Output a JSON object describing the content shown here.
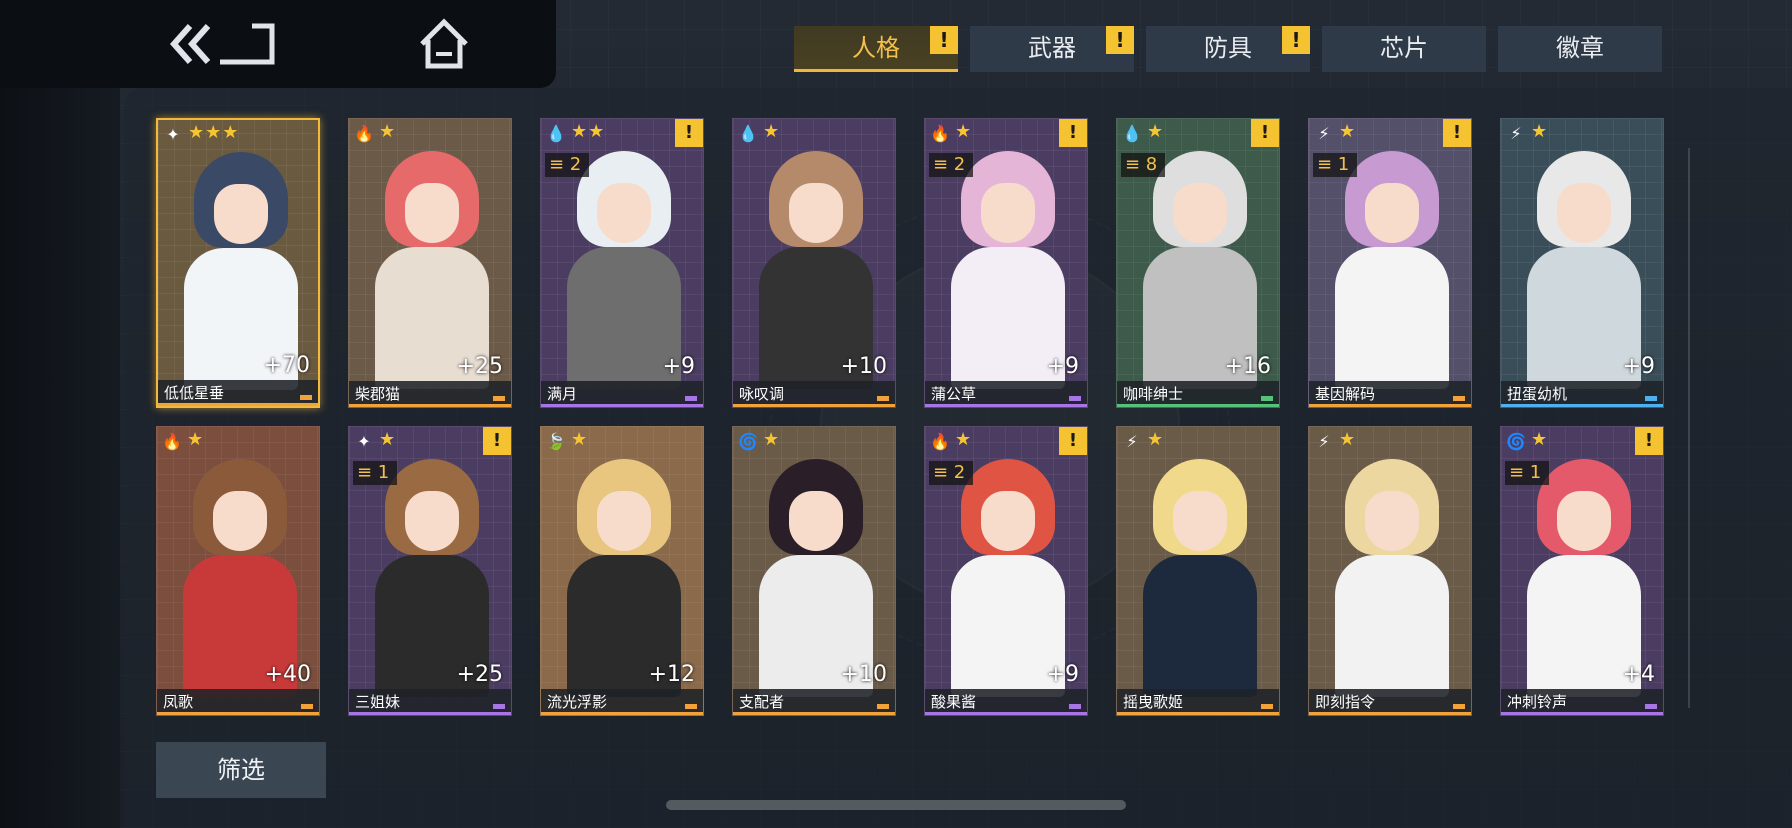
{
  "nav": {
    "back_label": "",
    "home_label": ""
  },
  "tabs": [
    {
      "label": "人格",
      "alert": "!",
      "active": true
    },
    {
      "label": "武器",
      "alert": "!"
    },
    {
      "label": "防具",
      "alert": "!"
    },
    {
      "label": "芯片",
      "alert": ""
    },
    {
      "label": "徽章",
      "alert": ""
    }
  ],
  "cards": [
    {
      "name": "低低星垂",
      "level": "+70",
      "stars": "★★★",
      "element": "✦",
      "elementColor": "#ffffff",
      "alert": "",
      "rank": "",
      "bg": "#6a5a40",
      "hair": "#3a4a66",
      "body": "#f2f5f8",
      "tag": "#f2a23a",
      "selected": true
    },
    {
      "name": "柴郡猫",
      "level": "+25",
      "stars": "★",
      "element": "🔥",
      "elementColor": "#ff5b3a",
      "alert": "",
      "rank": "",
      "bg": "#6c5a48",
      "hair": "#e66a6a",
      "body": "#e7ddd1",
      "tag": "#f2a23a"
    },
    {
      "name": "满月",
      "level": "+9",
      "stars": "★★",
      "element": "💧",
      "elementColor": "#6ec1ff",
      "alert": "!",
      "rank": "≡ 2",
      "bg": "#4b3c62",
      "hair": "#e9eef2",
      "body": "#6e6e6e",
      "tag": "#a874e6"
    },
    {
      "name": "咏叹调",
      "level": "+10",
      "stars": "★",
      "element": "💧",
      "elementColor": "#6ec1ff",
      "alert": "",
      "rank": "",
      "bg": "#4b3c62",
      "hair": "#b48a6a",
      "body": "#333333",
      "tag": "#f2a23a"
    },
    {
      "name": "蒲公草",
      "level": "+9",
      "stars": "★",
      "element": "🔥",
      "elementColor": "#ff5b3a",
      "alert": "!",
      "rank": "≡ 2",
      "bg": "#4b3c62",
      "hair": "#e5b5d8",
      "body": "#f3eef6",
      "tag": "#a874e6"
    },
    {
      "name": "咖啡绅士",
      "level": "+16",
      "stars": "★",
      "element": "💧",
      "elementColor": "#6ec1ff",
      "alert": "!",
      "rank": "≡ 8",
      "bg": "#3d5a4a",
      "hair": "#dedede",
      "body": "#c0c0c0",
      "tag": "#55c27a"
    },
    {
      "name": "基因解码",
      "level": "",
      "stars": "★",
      "element": "⚡",
      "elementColor": "#ffffff",
      "alert": "!",
      "rank": "≡ 1",
      "bg": "#55506a",
      "hair": "#c79ad1",
      "body": "#f4f4f4",
      "tag": "#f2a23a"
    },
    {
      "name": "扭蛋幼机",
      "level": "+9",
      "stars": "★",
      "element": "⚡",
      "elementColor": "#ffffff",
      "alert": "",
      "rank": "",
      "bg": "#3a4e5a",
      "hair": "#e8e8e8",
      "body": "#cfd8dc",
      "tag": "#4fb0ee"
    },
    {
      "name": "凤歌",
      "level": "+40",
      "stars": "★",
      "element": "🔥",
      "elementColor": "#ff5b3a",
      "alert": "",
      "rank": "",
      "bg": "#7b4e3e",
      "hair": "#8a5a3a",
      "body": "#c83a3a",
      "tag": "#f2a23a"
    },
    {
      "name": "三姐妹",
      "level": "+25",
      "stars": "★",
      "element": "✦",
      "elementColor": "#ffffff",
      "alert": "!",
      "rank": "≡ 1",
      "bg": "#4b3c62",
      "hair": "#9a6a42",
      "body": "#2b2b2b",
      "tag": "#a874e6"
    },
    {
      "name": "流光浮影",
      "level": "+12",
      "stars": "★",
      "element": "🍃",
      "elementColor": "#6ed37a",
      "alert": "",
      "rank": "",
      "bg": "#8a6a4a",
      "hair": "#e8c680",
      "body": "#2b2b2b",
      "tag": "#f2a23a"
    },
    {
      "name": "支配者",
      "level": "+10",
      "stars": "★",
      "element": "🌀",
      "elementColor": "#c17bea",
      "alert": "",
      "rank": "",
      "bg": "#6a5a48",
      "hair": "#2a1e28",
      "body": "#ececec",
      "tag": "#f2a23a"
    },
    {
      "name": "酸果酱",
      "level": "+9",
      "stars": "★",
      "element": "🔥",
      "elementColor": "#ff5b3a",
      "alert": "!",
      "rank": "≡ 2",
      "bg": "#4b3c62",
      "hair": "#e05444",
      "body": "#f4f4f4",
      "tag": "#a874e6"
    },
    {
      "name": "摇曳歌姬",
      "level": "",
      "stars": "★",
      "element": "⚡",
      "elementColor": "#ffffff",
      "alert": "",
      "rank": "",
      "bg": "#6a5a48",
      "hair": "#f0d98a",
      "body": "#1d2a3e",
      "tag": "#f2a23a"
    },
    {
      "name": "即刻指令",
      "level": "",
      "stars": "★",
      "element": "⚡",
      "elementColor": "#ffffff",
      "alert": "",
      "rank": "",
      "bg": "#6a5a48",
      "hair": "#ecd7a0",
      "body": "#f2f2f2",
      "tag": "#f2a23a"
    },
    {
      "name": "冲刺铃声",
      "level": "+4",
      "stars": "★",
      "element": "🌀",
      "elementColor": "#c17bea",
      "alert": "!",
      "rank": "≡ 1",
      "bg": "#4b3c62",
      "hair": "#e45a6a",
      "body": "#f4f4f4",
      "tag": "#a874e6"
    }
  ],
  "filter_label": "筛选"
}
